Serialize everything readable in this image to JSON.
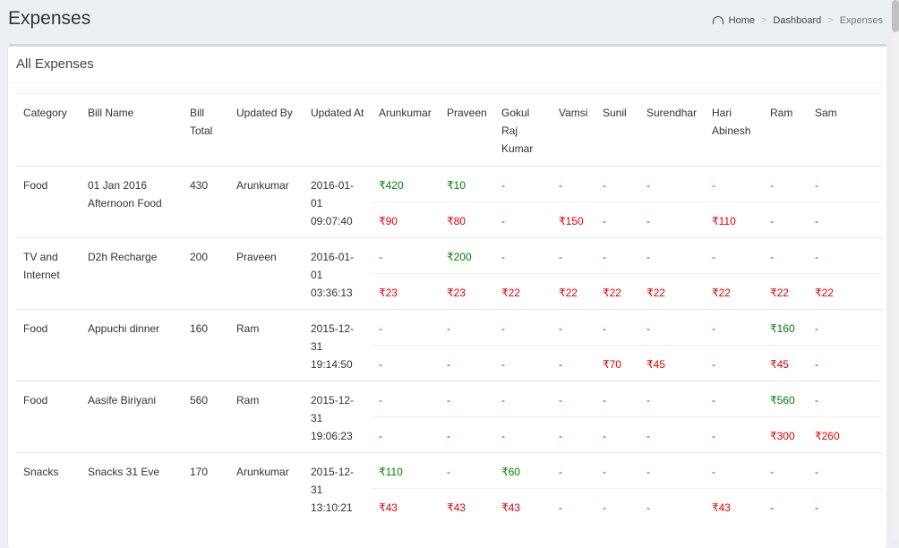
{
  "header": {
    "title": "Expenses",
    "breadcrumb": {
      "home": "Home",
      "dashboard": "Dashboard",
      "current": "Expenses",
      "separator": ">"
    }
  },
  "box": {
    "title": "All Expenses"
  },
  "table": {
    "columns": [
      "Category",
      "Bill Name",
      "Bill Total",
      "Updated By",
      "Updated At",
      "Arunkumar",
      "Praveen",
      "Gokul Raj Kumar",
      "Vamsi",
      "Sunil",
      "Surendhar",
      "Hari Abinesh",
      "Ram",
      "Sam"
    ],
    "rows": [
      {
        "category": "Food",
        "bill_name": "01 Jan 2016 Afternoon Food",
        "bill_total": "430",
        "updated_by": "Arunkumar",
        "updated_at": "2016-01-01 09:07:40",
        "paid": [
          "₹420",
          "₹10",
          "-",
          "-",
          "-",
          "-",
          "-",
          "-",
          "-"
        ],
        "share": [
          "₹90",
          "₹80",
          "-",
          "₹150",
          "-",
          "-",
          "₹110",
          "-",
          "-"
        ]
      },
      {
        "category": "TV and Internet",
        "bill_name": "D2h Recharge",
        "bill_total": "200",
        "updated_by": "Praveen",
        "updated_at": "2016-01-01 03:36:13",
        "paid": [
          "-",
          "₹200",
          "-",
          "-",
          "-",
          "-",
          "-",
          "-",
          "-"
        ],
        "share": [
          "₹23",
          "₹23",
          "₹22",
          "₹22",
          "₹22",
          "₹22",
          "₹22",
          "₹22",
          "₹22"
        ]
      },
      {
        "category": "Food",
        "bill_name": "Appuchi dinner",
        "bill_total": "160",
        "updated_by": "Ram",
        "updated_at": "2015-12-31 19:14:50",
        "paid": [
          "-",
          "-",
          "-",
          "-",
          "-",
          "-",
          "-",
          "₹160",
          "-"
        ],
        "share": [
          "-",
          "-",
          "-",
          "-",
          "₹70",
          "₹45",
          "-",
          "₹45",
          "-"
        ]
      },
      {
        "category": "Food",
        "bill_name": "Aasife Biriyani",
        "bill_total": "560",
        "updated_by": "Ram",
        "updated_at": "2015-12-31 19:06:23",
        "paid": [
          "-",
          "-",
          "-",
          "-",
          "-",
          "-",
          "-",
          "₹560",
          "-"
        ],
        "share": [
          "-",
          "-",
          "-",
          "-",
          "-",
          "-",
          "-",
          "₹300",
          "₹260"
        ]
      },
      {
        "category": "Snacks",
        "bill_name": "Snacks 31 Eve",
        "bill_total": "170",
        "updated_by": "Arunkumar",
        "updated_at": "2015-12-31 13:10:21",
        "paid": [
          "₹110",
          "-",
          "₹60",
          "-",
          "-",
          "-",
          "-",
          "-",
          "-"
        ],
        "share": [
          "₹43",
          "₹43",
          "₹43",
          "-",
          "-",
          "-",
          "₹43",
          "-",
          "-"
        ]
      }
    ]
  },
  "colors": {
    "paid": "#008000",
    "share": "#e00000",
    "background": "#ecf0f5"
  },
  "icons": {
    "home": "dashboard-icon"
  }
}
